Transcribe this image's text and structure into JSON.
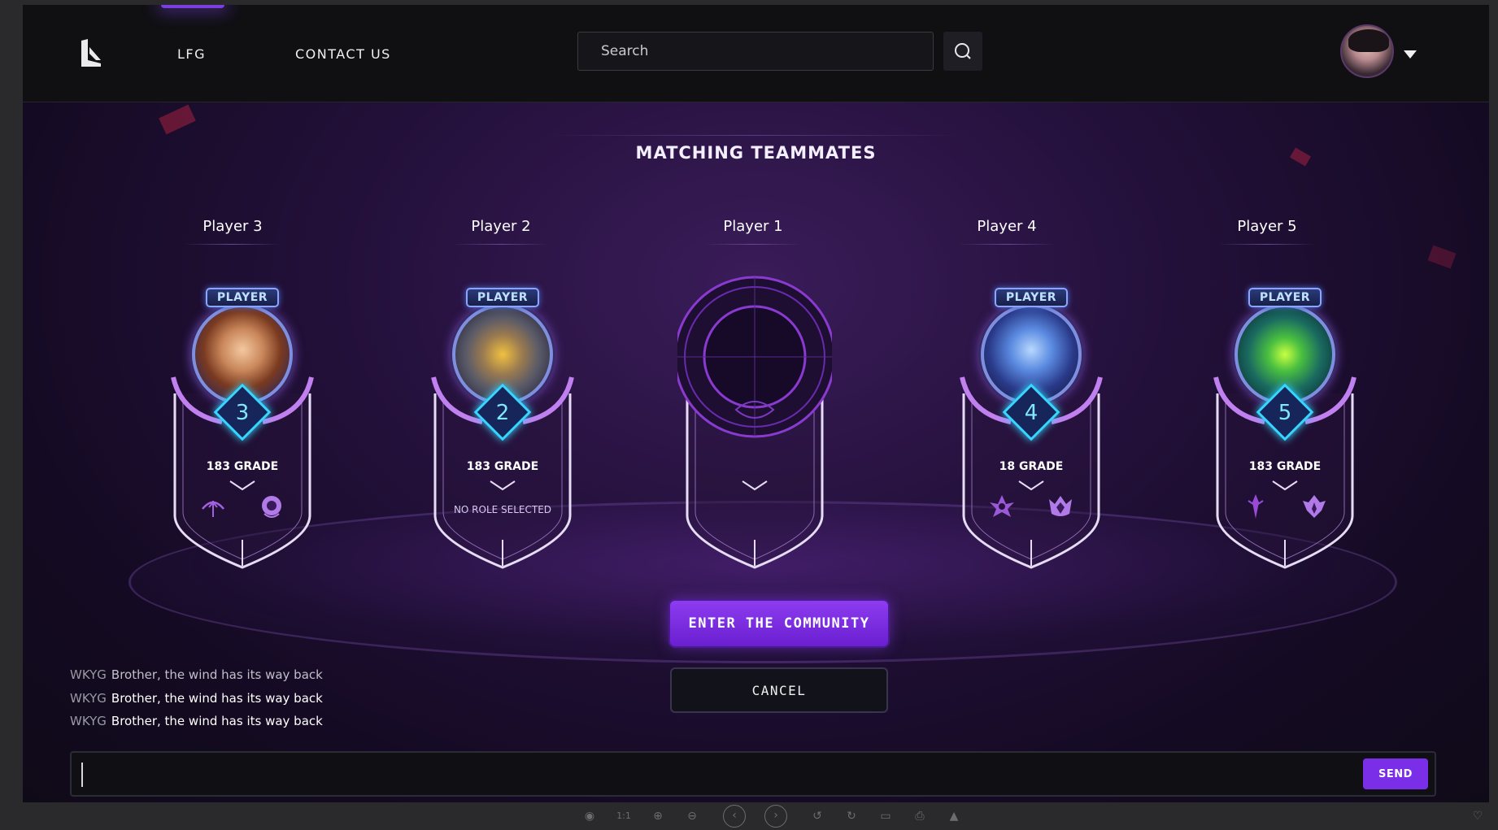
{
  "nav": {
    "items": [
      {
        "label": "LFG",
        "icon": "lfg-nav"
      },
      {
        "label": "CONTACT US"
      }
    ]
  },
  "search": {
    "placeholder": "Search",
    "icon": "search-icon"
  },
  "user": {
    "avatar": "user-avatar",
    "menu_icon": "caret-down-icon"
  },
  "main": {
    "title": "MATCHING TEAMMATES",
    "players": [
      {
        "label": "Player 3",
        "badge": "PLAYER",
        "rank": "3",
        "grade": "183 GRADE",
        "roles": [
          "bow-role-icon",
          "mage-role-icon"
        ]
      },
      {
        "label": "Player 2",
        "badge": "PLAYER",
        "rank": "2",
        "grade": "183 GRADE",
        "role_text": "NO ROLE SELECTED"
      },
      {
        "label": "Player 1",
        "empty": true
      },
      {
        "label": "Player 4",
        "badge": "PLAYER",
        "rank": "4",
        "grade": "18 GRADE",
        "roles": [
          "assassin-role-icon",
          "tank-role-icon"
        ]
      },
      {
        "label": "Player 5",
        "badge": "PLAYER",
        "rank": "5",
        "grade": "183 GRADE",
        "roles": [
          "marksman-role-icon",
          "support-role-icon"
        ]
      }
    ],
    "enter_button": "ENTER THE COMMUNITY",
    "cancel_button": "CANCEL"
  },
  "chat": {
    "messages": [
      {
        "user": "WKYG",
        "text": "Brother, the wind has its way back"
      },
      {
        "user": "WKYG",
        "text": "Brother, the wind has its way back"
      },
      {
        "user": "WKYG",
        "text": "Brother, the wind has its way back"
      }
    ],
    "send_label": "SEND"
  },
  "colors": {
    "accent": "#7a2ee8",
    "rank_glow": "#36d6ff",
    "background": "#140a22"
  }
}
